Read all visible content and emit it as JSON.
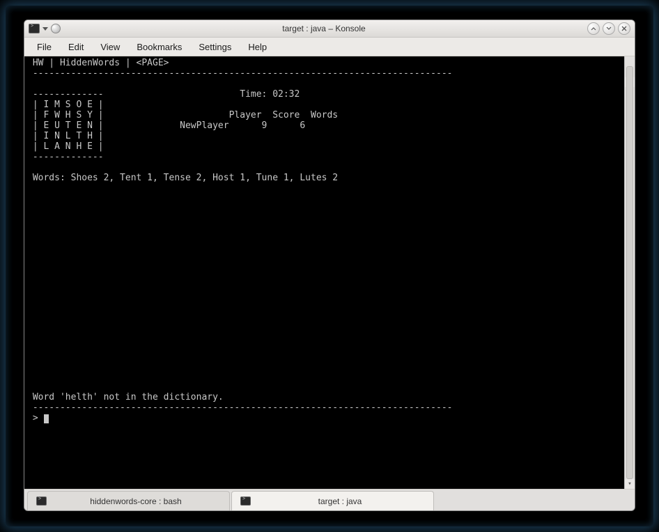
{
  "window": {
    "title": "target : java – Konsole"
  },
  "menubar": {
    "items": [
      "File",
      "Edit",
      "View",
      "Bookmarks",
      "Settings",
      "Help"
    ]
  },
  "terminal": {
    "header": " HW | HiddenWords | <PAGE>",
    "rule": " -----------------------------------------------------------------------------",
    "grid_top": " -------------",
    "time_line": "                         Time: 02:32",
    "grid": [
      " | I M S O E |",
      " | F W H S Y |                       Player  Score  Words",
      " | E U T E N |              NewPlayer      9      6",
      " | I N L T H |",
      " | L A N H E |"
    ],
    "grid_bottom": " -------------",
    "words_line": " Words: Shoes 2, Tent 1, Tense 2, Host 1, Tune 1, Lutes 2",
    "error_line": " Word 'helth' not in the dictionary.",
    "prompt": " > "
  },
  "tabs": [
    {
      "label": "hiddenwords-core : bash",
      "active": false
    },
    {
      "label": "target : java",
      "active": true
    }
  ]
}
